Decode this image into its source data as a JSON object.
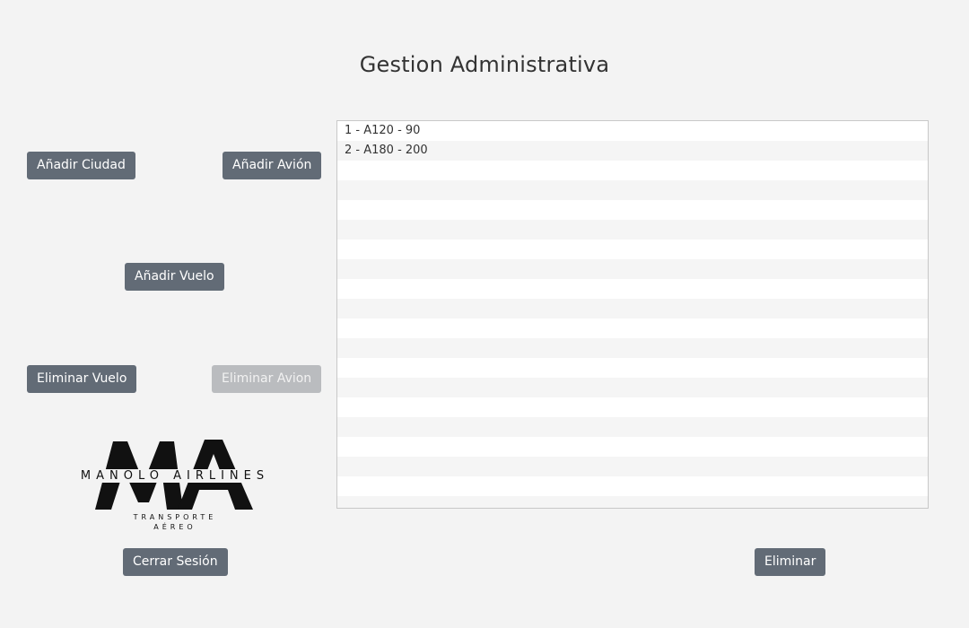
{
  "header": {
    "title": "Gestion Administrativa"
  },
  "buttons": {
    "add_city": "Añadir Ciudad",
    "add_plane": "Añadir Avión",
    "add_flight": "Añadir Vuelo",
    "delete_flight": "Eliminar Vuelo",
    "delete_plane": "Eliminar Avion",
    "logout": "Cerrar Sesión",
    "delete": "Eliminar"
  },
  "list": {
    "items": [
      "1 - A120 - 90",
      "2 - A180 - 200"
    ]
  },
  "logo": {
    "mark": "MA",
    "name": "MANOLO AIRLINES",
    "tagline_1": "TRANSPORTE",
    "tagline_2": "AÉREO"
  },
  "colors": {
    "button": "#626b76",
    "button_disabled": "#babcbf",
    "background": "#f3f3f3"
  }
}
